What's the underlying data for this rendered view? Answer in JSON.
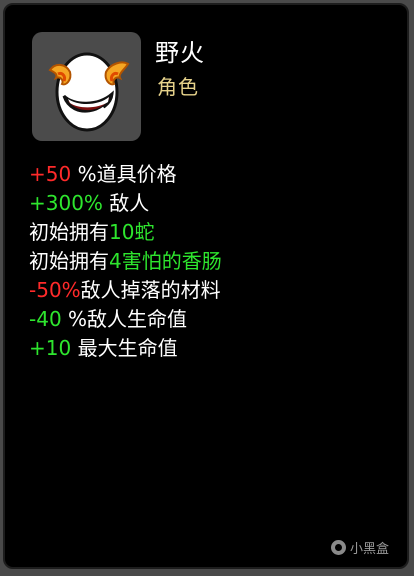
{
  "character": {
    "name": "野火",
    "type": "角色",
    "portrait_icon": "egg-face-with-flames-icon"
  },
  "colors": {
    "negative": "#ff2a2a",
    "positive": "#2ee62e",
    "text": "#ffffff",
    "subtitle": "#e6d28b",
    "panel": "#000000",
    "portrait_bg": "#4b4b4b"
  },
  "stats": [
    {
      "value": "+50",
      "value_color": "negative",
      "suffix": " %道具价格"
    },
    {
      "value": "+300%",
      "value_color": "positive",
      "suffix": " 敌人"
    },
    {
      "prefix": "初始拥有",
      "value": "10蛇",
      "value_color": "positive"
    },
    {
      "prefix": "初始拥有",
      "value": "4害怕的香肠",
      "value_color": "positive"
    },
    {
      "value": "-50%",
      "value_color": "negative",
      "suffix": "敌人掉落的材料"
    },
    {
      "value": "-40",
      "value_color": "positive",
      "suffix": " %敌人生命值"
    },
    {
      "value": "+10",
      "value_color": "positive",
      "suffix": " 最大生命值"
    }
  ],
  "watermark": {
    "text": "小黑盒",
    "icon": "xiaoheihe-logo-icon"
  }
}
